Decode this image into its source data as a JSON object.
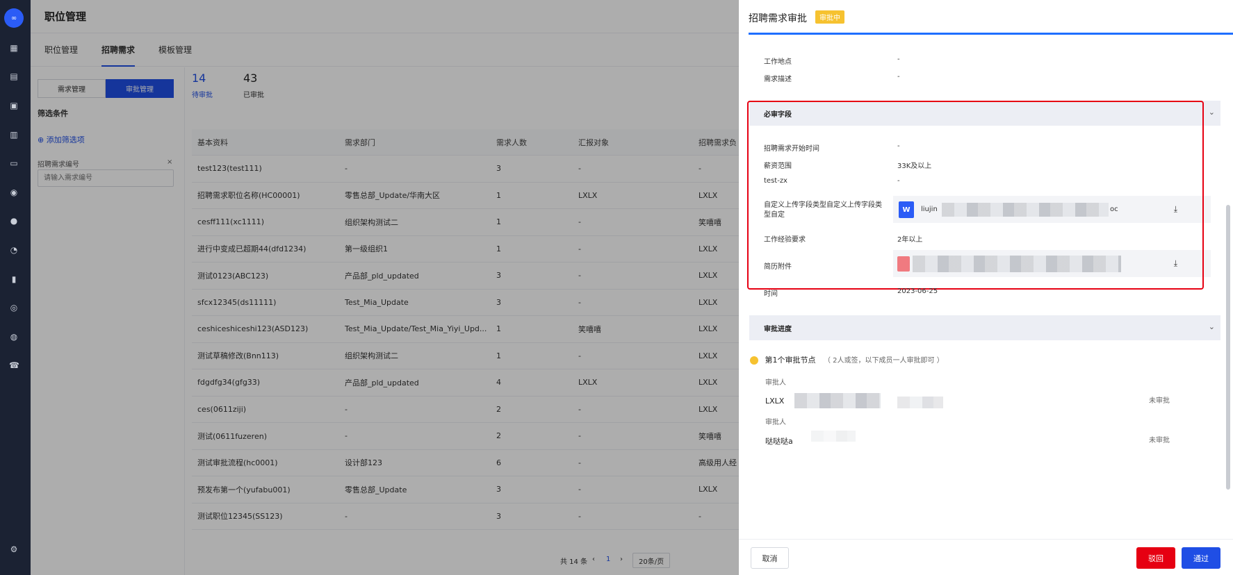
{
  "rail": {
    "logo_text": "∞",
    "icons": [
      "dashboard-icon",
      "briefcase-icon",
      "calendar-doc-icon",
      "table-icon",
      "id-card-icon",
      "chat-icon",
      "badge-icon",
      "pie-chart-icon",
      "bar-chart-icon",
      "person-icon",
      "users-icon",
      "phone-icon",
      "settings-icon"
    ]
  },
  "header": {
    "title": "职位管理"
  },
  "tabs": [
    {
      "label": "职位管理",
      "active": false
    },
    {
      "label": "招聘需求",
      "active": true
    },
    {
      "label": "模板管理",
      "active": false
    }
  ],
  "left": {
    "seg": [
      "需求管理",
      "审批管理"
    ],
    "filter_title": "筛选条件",
    "add_filter": "添加筛选项",
    "field_label": "招聘需求编号",
    "field_close": "×",
    "field_placeholder": "请输入需求编号"
  },
  "stats": [
    {
      "num": "14",
      "label": "待审批"
    },
    {
      "num": "43",
      "label": "已审批"
    }
  ],
  "table": {
    "headers": [
      "基本资料",
      "需求部门",
      "需求人数",
      "汇报对象",
      "招聘需求负"
    ],
    "rows": [
      [
        "test123(test111)",
        "-",
        "3",
        "-",
        "-"
      ],
      [
        "招聘需求职位名称(HC00001)",
        "零售总部_Update/华南大区",
        "1",
        "LXLX",
        "LXLX"
      ],
      [
        "cesff111(xc1111)",
        "组织架构测试二",
        "1",
        "-",
        "笑嘻嘻"
      ],
      [
        "进行中变成已超期44(dfd1234)",
        "第一级组织1",
        "1",
        "-",
        "LXLX"
      ],
      [
        "测试0123(ABC123)",
        "产品部_pld_updated",
        "3",
        "-",
        "LXLX"
      ],
      [
        "sfcx12345(ds11111)",
        "Test_Mia_Update",
        "3",
        "-",
        "LXLX"
      ],
      [
        "ceshiceshiceshi123(ASD123)",
        "Test_Mia_Update/Test_Mia_Yiyi_Upd...",
        "1",
        "笑嘻嘻",
        "LXLX"
      ],
      [
        "测试草稿修改(Bnn113)",
        "组织架构测试二",
        "1",
        "-",
        "LXLX"
      ],
      [
        "fdgdfg34(gfg33)",
        "产品部_pld_updated",
        "4",
        "LXLX",
        "LXLX"
      ],
      [
        "ces(0611ziji)",
        "-",
        "2",
        "-",
        "LXLX"
      ],
      [
        "测试(0611fuzeren)",
        "-",
        "2",
        "-",
        "笑嘻嘻"
      ],
      [
        "测试审批流程(hc0001)",
        "设计部123",
        "6",
        "-",
        "高级用人经"
      ],
      [
        "预发布第一个(yufabu001)",
        "零售总部_Update",
        "3",
        "-",
        "LXLX"
      ],
      [
        "测试职位12345(SS123)",
        "-",
        "3",
        "-",
        "-"
      ]
    ]
  },
  "pager": {
    "total": "共 14 条",
    "prev": "‹",
    "page": "1",
    "next": "›",
    "size": "20条/页"
  },
  "drawer": {
    "title": "招聘需求审批",
    "badge": "审批中",
    "fields_top": [
      {
        "k": "工作地点",
        "v": "-"
      },
      {
        "k": "需求描述",
        "v": "-"
      }
    ],
    "section_required": "必审字段",
    "fields_required": [
      {
        "k": "招聘需求开始时间",
        "v": "-"
      },
      {
        "k": "薪资范围",
        "v": "33K及以上"
      },
      {
        "k": "test-zx",
        "v": "-"
      }
    ],
    "custom_upload_label": "自定义上传字段类型自定义上传字段类型自定",
    "file1_prefix": "liujin",
    "file1_suffix": "oc",
    "work_exp_label": "工作经验要求",
    "work_exp_value": "2年以上",
    "resume_label": "简历附件",
    "time_label": "时间",
    "time_value": "2023-06-25",
    "section_progress": "审批进度",
    "node_title": "第1个审批节点",
    "node_note": "（ 2人或签，以下成员一人审批即可 ）",
    "approvers": [
      {
        "role": "审批人",
        "name": "LXLX",
        "status": "未审批"
      },
      {
        "role": "审批人",
        "name": "哒哒哒a",
        "status": "未审批"
      }
    ],
    "buttons": {
      "cancel": "取消",
      "reject": "驳回",
      "pass": "通过"
    }
  },
  "colors": {
    "accent": "#1f4ee5",
    "danger": "#e60012",
    "warning": "#f6c230"
  }
}
